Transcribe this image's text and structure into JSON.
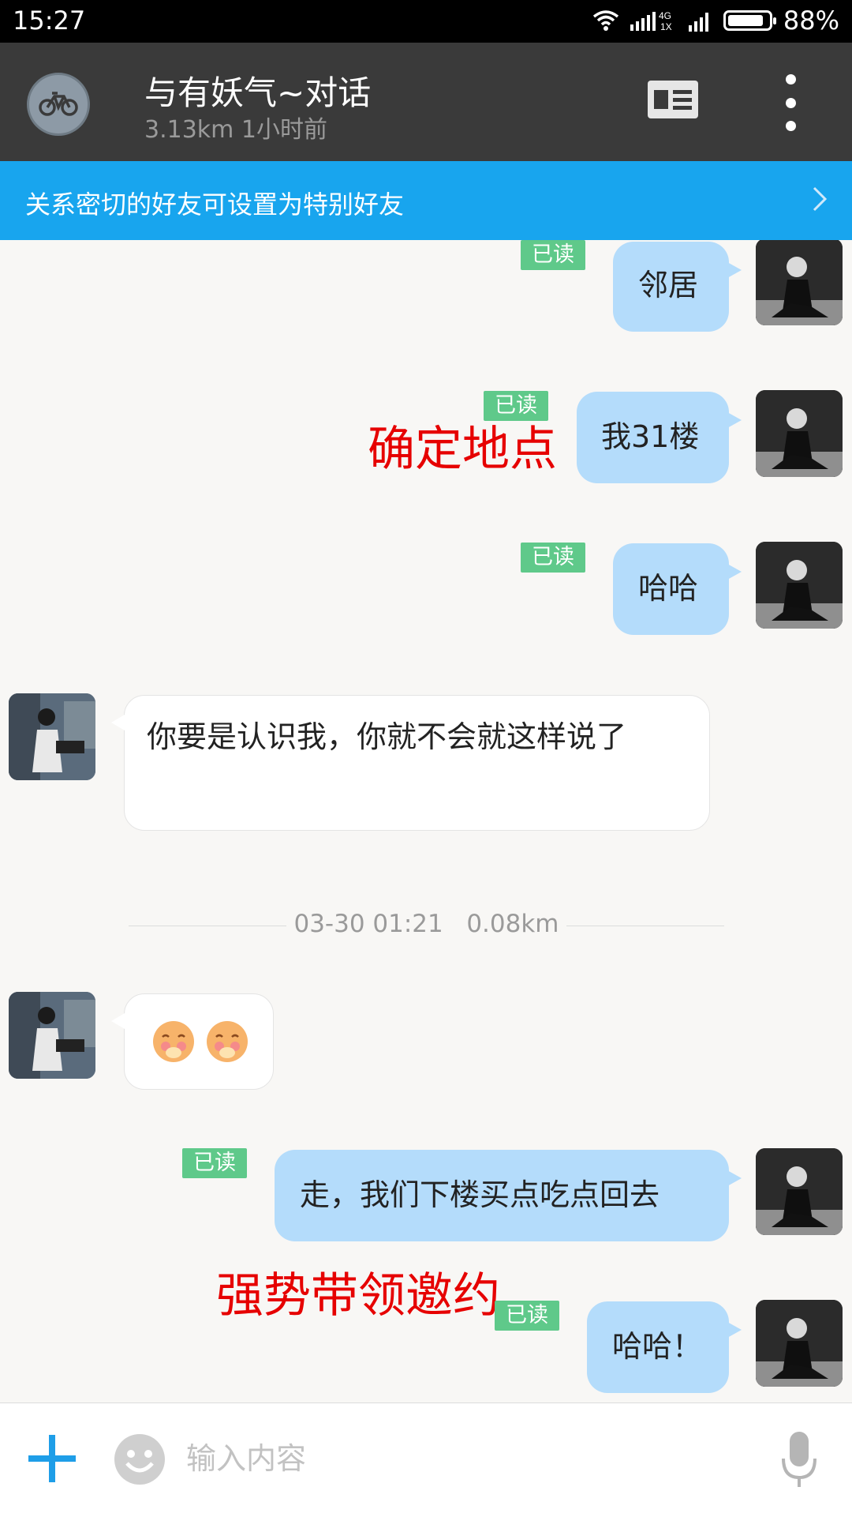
{
  "status_bar": {
    "time": "15:27",
    "network_label": "4G\n1X",
    "battery": "88%",
    "battery_level": 0.88
  },
  "header": {
    "title": "与有妖气~对话",
    "subtitle": "3.13km 1小时前",
    "avatar_icon": "bicycle-icon",
    "profile_icon": "profile-card-icon",
    "more_icon": "more-vertical-icon"
  },
  "banner": {
    "text": "关系密切的好友可设置为特别好友",
    "icon": "chevron-right-icon"
  },
  "messages": [
    {
      "side": "mine",
      "text": "邻居",
      "status": "已读"
    },
    {
      "side": "mine",
      "text": "我31楼",
      "status": "已读"
    },
    {
      "side": "mine",
      "text": "哈哈",
      "status": "已读"
    },
    {
      "side": "theirs",
      "text": "你要是认识我，你就不会就这样说了"
    },
    {
      "side": "theirs",
      "text": "",
      "emoji": "blushing-emoji",
      "count": 2
    },
    {
      "side": "mine",
      "text": "走，我们下楼买点吃点回去",
      "status": "已读"
    },
    {
      "side": "mine",
      "text": "哈哈！",
      "status": "已读"
    }
  ],
  "separator": {
    "time": "03-30 01:21",
    "distance": "0.08km"
  },
  "annotations": [
    {
      "text": "确定地点",
      "color": "#e60000"
    },
    {
      "text": "强势带领邀约",
      "color": "#e60000"
    }
  ],
  "input_bar": {
    "placeholder": "输入内容",
    "plus_icon": "plus-icon",
    "emoji_icon": "emoji-icon",
    "mic_icon": "microphone-icon"
  },
  "colors": {
    "header_bg": "#3a3a3a",
    "banner_bg": "#18a5ee",
    "my_bubble": "#b4dcfb",
    "read_badge": "#5fc98a",
    "accent": "#1e9ee8"
  }
}
